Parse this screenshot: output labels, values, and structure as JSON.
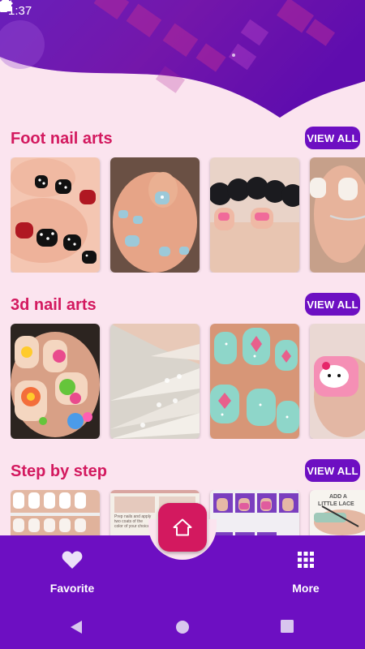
{
  "status_bar": {
    "time": "1:37",
    "icons_left": [
      "settings-icon",
      "shield-icon",
      "sd-card-icon"
    ],
    "icons_right": [
      "wifi-icon",
      "signal-icon",
      "battery-icon"
    ]
  },
  "colors": {
    "primary": "#6d0fc2",
    "accent": "#d3195f",
    "background": "#fbe4ef"
  },
  "sections": [
    {
      "title": "Foot nail arts",
      "view_all_label": "VIEW ALL",
      "thumbnails": [
        "foot-nails-polka-dot",
        "foot-nails-blue-fish",
        "foot-nails-pink-lips",
        "foot-nails-french-ring"
      ]
    },
    {
      "title": "3d nail arts",
      "view_all_label": "VIEW ALL",
      "thumbnails": [
        "3d-nails-floral",
        "3d-nails-white-stiletto",
        "3d-nails-teal-hearts",
        "3d-nails-hello-kitty"
      ]
    },
    {
      "title": "Step by step",
      "view_all_label": "VIEW ALL",
      "thumbnails": [
        "step-french-manicure",
        "step-tutorial-text",
        "step-purple-grid",
        "step-add-little-lace"
      ]
    }
  ],
  "step_thumb_text": {
    "tutorial": [
      "Prep nails and apply",
      "two coats of the",
      "color of your choice"
    ],
    "lace": [
      "ADD A",
      "LITTLE LACE"
    ]
  },
  "bottom_nav": {
    "favorite_label": "Favorite",
    "favorite_icon": "heart-icon",
    "home_icon": "home-icon",
    "more_label": "More",
    "more_icon": "grid-icon"
  },
  "system_nav": [
    "back-icon",
    "home-circle-icon",
    "recents-icon"
  ]
}
